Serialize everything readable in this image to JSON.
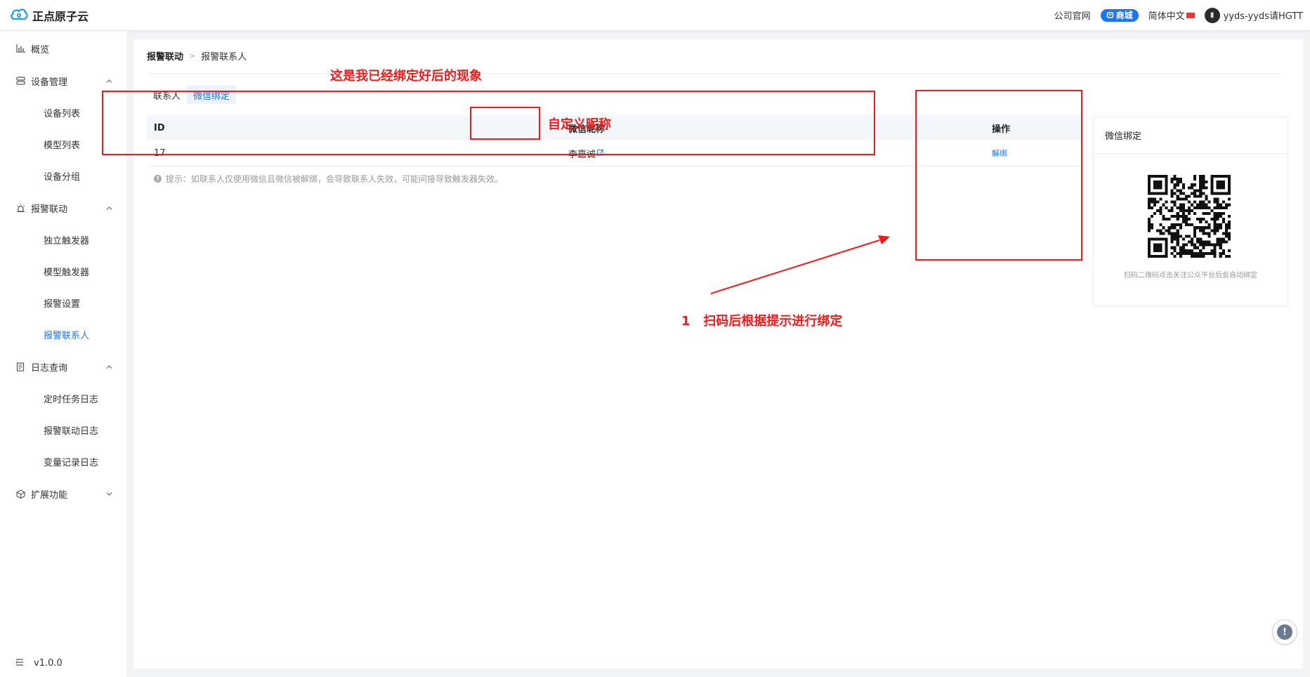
{
  "header": {
    "brand": "正点原子云",
    "company_site": "公司官网",
    "shop": "商城",
    "language": "简体中文",
    "username": "yyds-yyds请HGTT"
  },
  "sidebar": {
    "overview": "概览",
    "device_mgmt": "设备管理",
    "device_list": "设备列表",
    "model_list": "模型列表",
    "device_group": "设备分组",
    "alarm": "报警联动",
    "independent_trigger": "独立触发器",
    "model_trigger": "模型触发器",
    "alarm_settings": "报警设置",
    "alarm_contacts": "报警联系人",
    "log_query": "日志查询",
    "task_log": "定时任务日志",
    "alarm_log": "报警联动日志",
    "var_log": "变量记录日志",
    "extensions": "扩展功能",
    "version": "v1.0.0"
  },
  "breadcrumb": {
    "first": "报警联动",
    "second": "报警联系人"
  },
  "tabs": {
    "contacts": "联系人",
    "wechat_bind": "微信绑定"
  },
  "table": {
    "headers": {
      "id": "ID",
      "nickname": "微信昵称",
      "action": "操作"
    },
    "rows": [
      {
        "id": "17",
        "nickname": "李嘉诚",
        "action": "解绑"
      }
    ]
  },
  "tip": "提示：如联系人仅使用微信且微信被解绑，会导致联系人失效，可能间接导致触发器失效。",
  "wechat_card": {
    "title": "微信绑定",
    "caption": "扫码二维码点击关注公众平台后会自动绑定"
  },
  "annotations": {
    "bound_note": "这是我已经绑定好后的现象",
    "nickname_note": "自定义昵称",
    "scan_note": "1   扫码后根据提示进行绑定"
  },
  "colors": {
    "accent": "#1e73f5",
    "annotation": "#ee1c1c"
  }
}
